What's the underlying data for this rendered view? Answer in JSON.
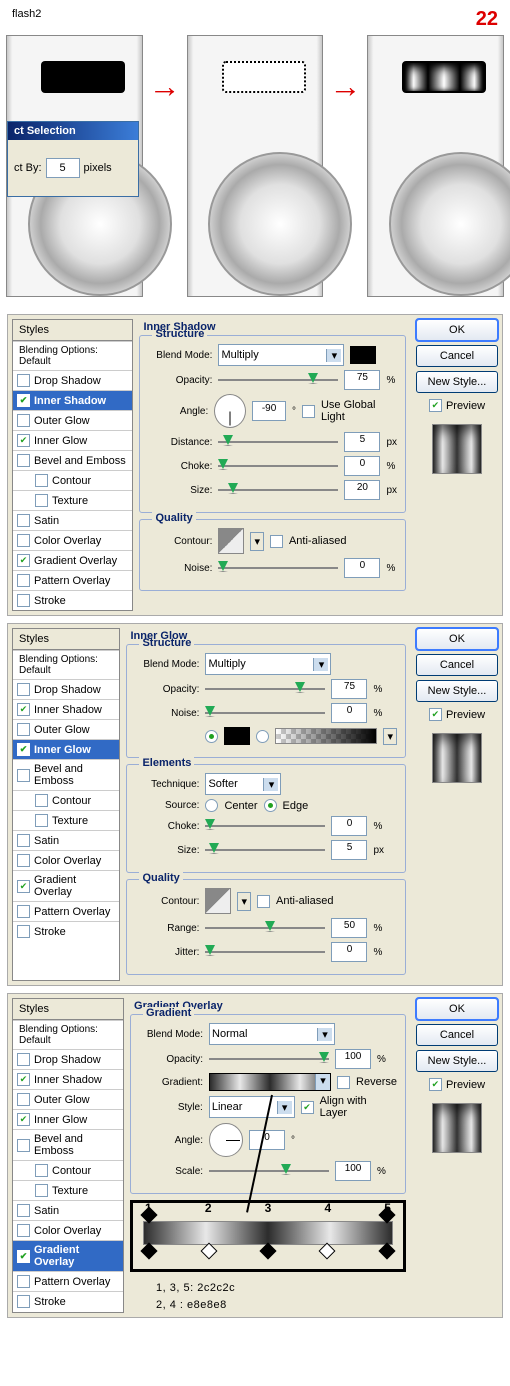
{
  "header": {
    "name": "flash2",
    "step": "22"
  },
  "sel_dialog": {
    "title": "ct Selection",
    "label": "ct By:",
    "value": "5",
    "unit": "pixels"
  },
  "styles_header": "Styles",
  "blend_opt": "Blending Options: Default",
  "items": [
    "Drop Shadow",
    "Inner Shadow",
    "Outer Glow",
    "Inner Glow",
    "Bevel and Emboss",
    "Contour",
    "Texture",
    "Satin",
    "Color Overlay",
    "Gradient Overlay",
    "Pattern Overlay",
    "Stroke"
  ],
  "d1": {
    "checked": [
      1,
      3,
      9
    ],
    "active": 1,
    "title": "Inner Shadow",
    "fs1": "Structure",
    "blend_mode": "Multiply",
    "opacity": "75",
    "angle": "-90",
    "global": "Use Global Light",
    "distance": "5",
    "choke": "0",
    "size": "20",
    "fs2": "Quality",
    "anti": "Anti-aliased",
    "noise": "0"
  },
  "d2": {
    "checked": [
      1,
      3,
      9
    ],
    "active": 3,
    "title": "Inner Glow",
    "fs1": "Structure",
    "blend_mode": "Multiply",
    "opacity": "75",
    "noise": "0",
    "fs2": "Elements",
    "technique": "Softer",
    "source": "Source:",
    "center": "Center",
    "edge": "Edge",
    "choke": "0",
    "size": "5",
    "fs3": "Quality",
    "anti": "Anti-aliased",
    "range": "50",
    "jitter": "0"
  },
  "d3": {
    "checked": [
      1,
      3,
      9
    ],
    "active": 9,
    "title": "Gradient Overlay",
    "fs1": "Gradient",
    "blend_mode": "Normal",
    "opacity": "100",
    "reverse": "Reverse",
    "align": "Align with Layer",
    "style": "Linear",
    "angle": "0",
    "scale": "100",
    "stops_legend1": "1, 3, 5:  2c2c2c",
    "stops_legend2": "2, 4     :  e8e8e8"
  },
  "labels": {
    "blend": "Blend Mode:",
    "opacity": "Opacity:",
    "angle": "Angle:",
    "distance": "Distance:",
    "choke": "Choke:",
    "size": "Size:",
    "contour": "Contour:",
    "noise": "Noise:",
    "technique": "Technique:",
    "range": "Range:",
    "jitter": "Jitter:",
    "gradient": "Gradient:",
    "style": "Style:",
    "scale": "Scale:"
  },
  "buttons": {
    "ok": "OK",
    "cancel": "Cancel",
    "newstyle": "New Style...",
    "preview": "Preview"
  },
  "units": {
    "pct": "%",
    "px": "px",
    "deg": "°"
  }
}
